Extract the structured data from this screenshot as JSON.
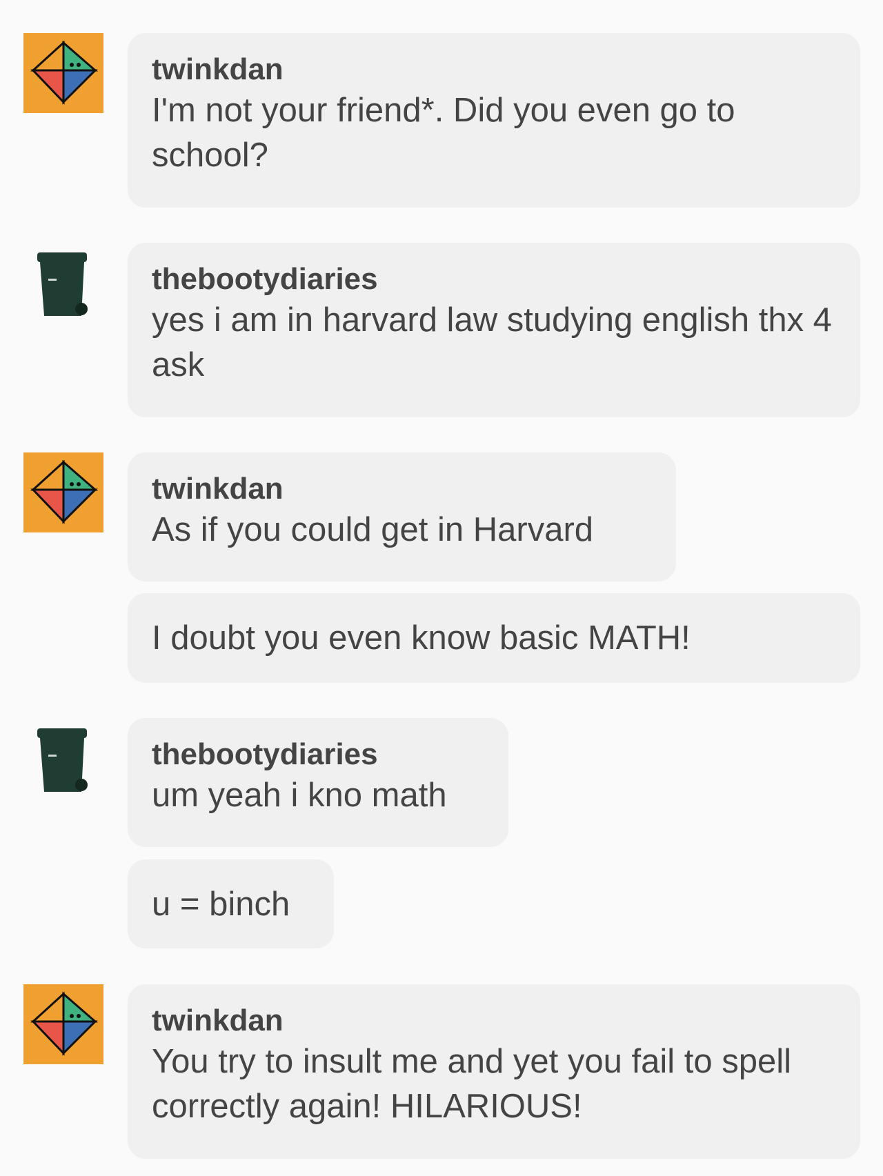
{
  "messages": [
    {
      "username": "twinkdan",
      "text": "I'm not your friend*. Did you even go to school?",
      "avatar": "twinkdan-avatar"
    },
    {
      "username": "thebootydiaries",
      "text": "yes i am in harvard law studying english thx 4 ask",
      "avatar": "trash-bin-avatar"
    },
    {
      "username": "twinkdan",
      "text": "As if you could get in Harvard",
      "avatar": "twinkdan-avatar"
    },
    {
      "text": "I doubt you even know basic MATH!"
    },
    {
      "username": "thebootydiaries",
      "text": "um yeah i kno math",
      "avatar": "trash-bin-avatar"
    },
    {
      "text": "u = binch"
    },
    {
      "username": "twinkdan",
      "text": "You try to insult me and yet you fail to spell correctly again! HILARIOUS!",
      "avatar": "twinkdan-avatar"
    }
  ],
  "colors": {
    "background": "#fafafa",
    "bubble": "#f0f0f0",
    "text": "#444444",
    "avatar_orange": "#f0a030",
    "trash_bin_green": "#1f3d33"
  }
}
